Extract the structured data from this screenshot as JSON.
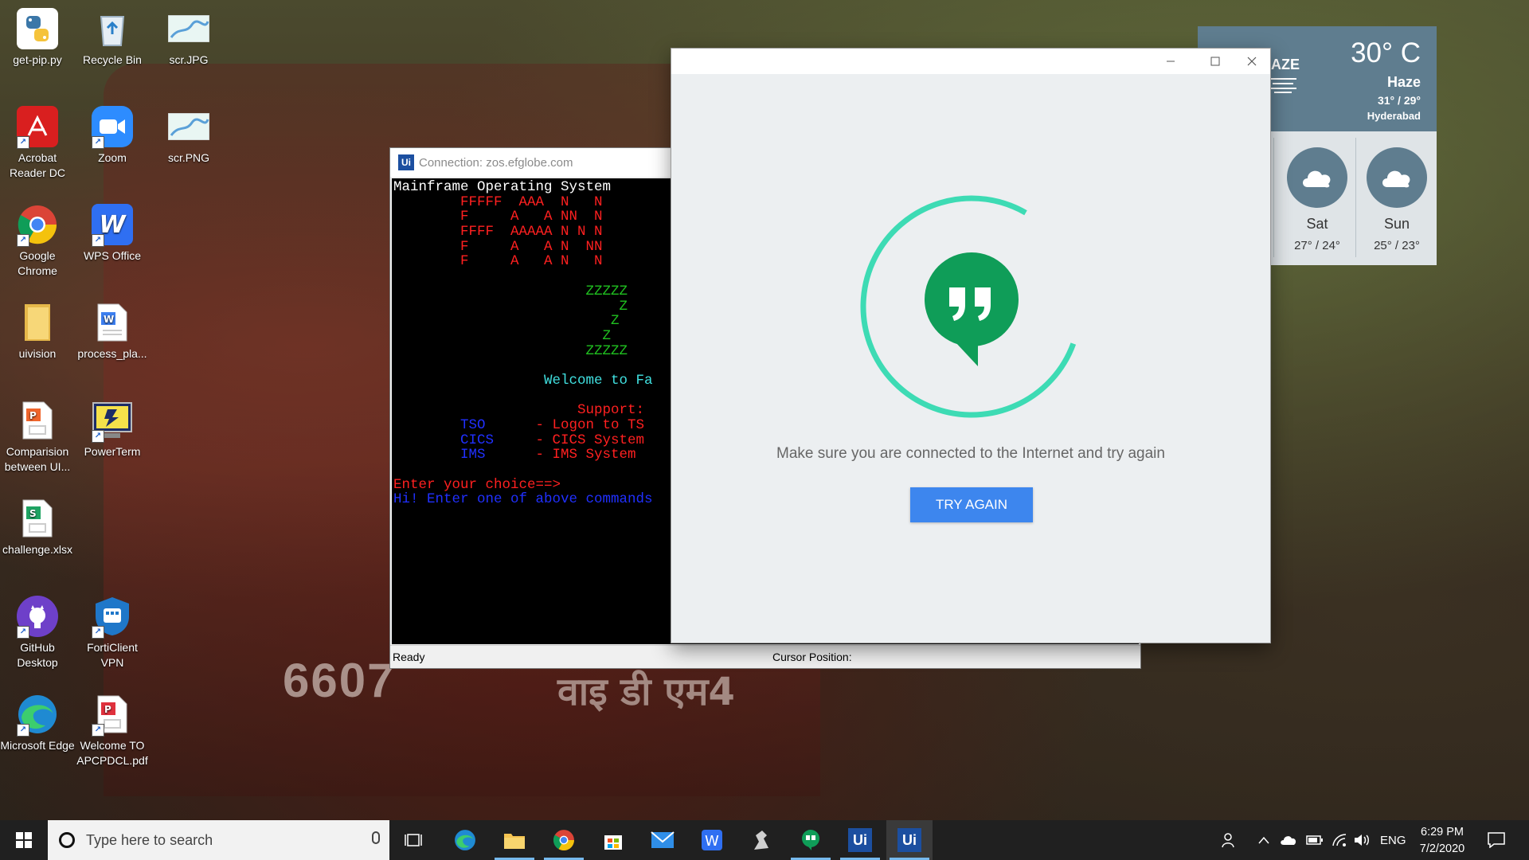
{
  "desktop": {
    "icons": [
      {
        "label": "get-pip.py"
      },
      {
        "label": "Recycle Bin"
      },
      {
        "label": "scr.JPG"
      },
      {
        "label": "Acrobat Reader DC"
      },
      {
        "label": "Zoom"
      },
      {
        "label": "scr.PNG"
      },
      {
        "label": "Google Chrome"
      },
      {
        "label": "WPS Office"
      },
      {
        "label": "uivision"
      },
      {
        "label": "process_pla..."
      },
      {
        "label": "Comparision between UI..."
      },
      {
        "label": "PowerTerm"
      },
      {
        "label": "challenge.xlsx"
      },
      {
        "label": "GitHub Desktop"
      },
      {
        "label": "FortiClient VPN"
      },
      {
        "label": "Microsoft Edge"
      },
      {
        "label": "Welcome TO APCPDCL.pdf"
      }
    ],
    "wallpaper_text": {
      "number": "6607",
      "script": "वाइ डी एम4"
    }
  },
  "mainframe": {
    "app_icon": "Ui",
    "title": "Connection: zos.efglobe.com",
    "lines": [
      {
        "text": "Mainframe Operating System",
        "color": "#ffffff"
      },
      {
        "text": "        FFFFF  AAA  N   N",
        "color": "#ff2020"
      },
      {
        "text": "        F     A   A NN  N",
        "color": "#ff2020"
      },
      {
        "text": "        FFFF  AAAAA N N N",
        "color": "#ff2020"
      },
      {
        "text": "        F     A   A N  NN",
        "color": "#ff2020"
      },
      {
        "text": "        F     A   A N   N",
        "color": "#ff2020"
      },
      {
        "text": "",
        "color": "#ffffff"
      },
      {
        "text": "                       ZZZZZ",
        "color": "#20c020"
      },
      {
        "text": "                           Z",
        "color": "#20c020"
      },
      {
        "text": "                          Z",
        "color": "#20c020"
      },
      {
        "text": "                         Z",
        "color": "#20c020"
      },
      {
        "text": "                       ZZZZZ",
        "color": "#20c020"
      },
      {
        "text": "",
        "color": "#ffffff"
      },
      {
        "text": "                  Welcome to Fa",
        "color": "#40e0e0"
      },
      {
        "text": "",
        "color": "#ffffff"
      },
      {
        "text": "                      Support: ",
        "color": "#ff2020"
      },
      {
        "text": "        TSO      - Logon to TS",
        "color": "#2030ff",
        "rest_color": "#ff2020"
      },
      {
        "text": "        CICS     - CICS System",
        "color": "#2030ff",
        "rest_color": "#ff2020"
      },
      {
        "text": "        IMS      - IMS System",
        "color": "#2030ff",
        "rest_color": "#ff2020"
      },
      {
        "text": "",
        "color": "#ffffff"
      },
      {
        "text": "Enter your choice==>",
        "color": "#ff2020"
      },
      {
        "text": "Hi! Enter one of above commands",
        "color": "#2030ff"
      }
    ],
    "status": {
      "ready": "Ready",
      "cursor_label": "Cursor Position:"
    }
  },
  "hangouts": {
    "message": "Make sure you are connected to the Internet and try again",
    "button": "TRY AGAIN",
    "accent": "#3ddbb4",
    "logo_color": "#0f9d58"
  },
  "weather": {
    "partial_label": "AZE",
    "temp": "30° C",
    "condition": "Haze",
    "hilo": "31° / 29°",
    "city": "Hyderabad",
    "forecast": [
      {
        "day": "Sat",
        "temps": "27° / 24°"
      },
      {
        "day": "Sun",
        "temps": "25° / 23°"
      }
    ]
  },
  "taskbar": {
    "search_placeholder": "Type here to search",
    "lang": "ENG",
    "time": "6:29 PM",
    "date": "7/2/2020",
    "ui_label": "Ui"
  }
}
